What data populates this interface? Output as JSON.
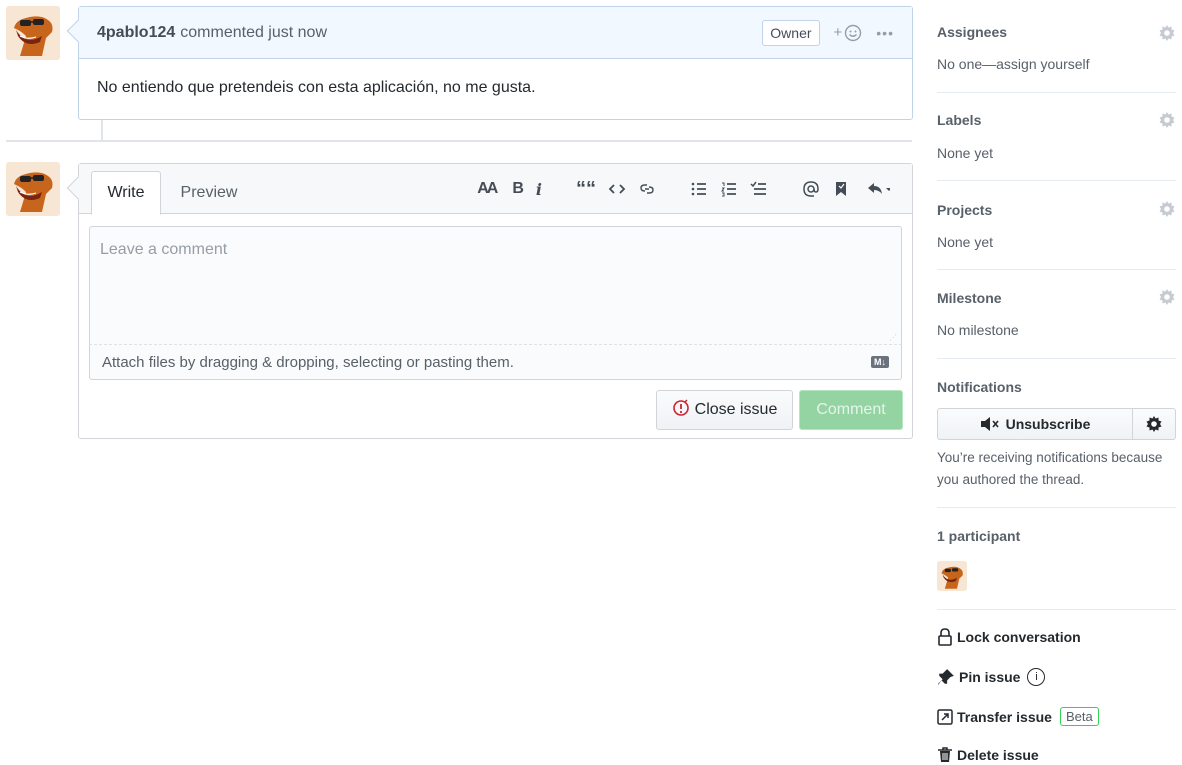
{
  "comment": {
    "author": "4pablo124",
    "meta": "commented just now",
    "owner_badge": "Owner",
    "react_icon": "smiley-icon",
    "react_plus": "+",
    "more": "•••",
    "body": "No entiendo que pretendeis con esta aplicación, no me gusta."
  },
  "form": {
    "tabs": {
      "write": "Write",
      "preview": "Preview"
    },
    "toolbar": {
      "heading": "AA",
      "bold": "B",
      "italic": "i",
      "quote": "““"
    },
    "placeholder": "Leave a comment",
    "attach_text": "Attach files by dragging & dropping, selecting or pasting them.",
    "markdown_badge": "M↓",
    "close_button": "Close issue",
    "comment_button": "Comment"
  },
  "sidebar": {
    "assignees": {
      "title": "Assignees",
      "value": "No one—assign yourself"
    },
    "labels": {
      "title": "Labels",
      "value": "None yet"
    },
    "projects": {
      "title": "Projects",
      "value": "None yet"
    },
    "milestone": {
      "title": "Milestone",
      "value": "No milestone"
    },
    "notifications": {
      "title": "Notifications",
      "button": "Unsubscribe",
      "text": "You’re receiving notifications because you authored the thread."
    },
    "participants": {
      "title": "1 participant"
    },
    "actions": {
      "lock": "Lock conversation",
      "pin": "Pin issue",
      "transfer": "Transfer issue",
      "beta": "Beta",
      "delete": "Delete issue"
    }
  },
  "colors": {
    "header_bg": "#f1f8ff",
    "comment_button": "#94d3a2",
    "close_icon": "#cb2431"
  }
}
